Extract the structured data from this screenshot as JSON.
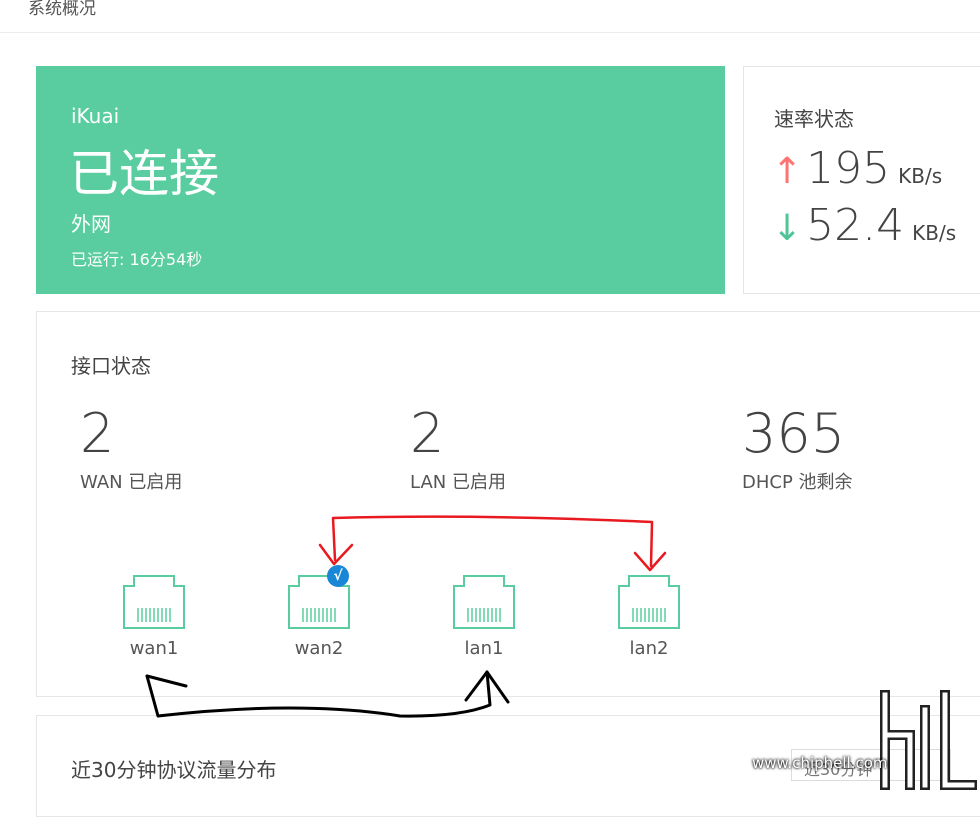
{
  "header": {
    "title": "系统概况"
  },
  "status": {
    "brand": "iKuai",
    "state": "已连接",
    "network": "外网",
    "uptime": "已运行: 16分54秒"
  },
  "rate": {
    "title": "速率状态",
    "upload": {
      "arrow": "↑",
      "value": "195",
      "unit": "KB/s"
    },
    "download": {
      "arrow": "↓",
      "value": "52.4",
      "unit": "KB/s"
    }
  },
  "interfaces": {
    "title": "接口状态",
    "stats": [
      {
        "value": "2",
        "label": "WAN 已启用"
      },
      {
        "value": "2",
        "label": "LAN 已启用"
      },
      {
        "value": "365",
        "label": "DHCP 池剩余"
      }
    ],
    "ports": [
      {
        "name": "wan1",
        "selected": false
      },
      {
        "name": "wan2",
        "selected": true,
        "badge": "√"
      },
      {
        "name": "lan1",
        "selected": false
      },
      {
        "name": "lan2",
        "selected": false
      }
    ]
  },
  "protocol": {
    "title": "近30分钟协议流量分布",
    "range": "近30分钟"
  },
  "watermark": {
    "logo": "chiphell",
    "url": "www.chiphell.com"
  },
  "colors": {
    "status_bg": "#59cd9f",
    "upload_arrow": "#ff7272",
    "download_arrow": "#4fc597",
    "port_outline": "#59cd9f",
    "badge": "#1a86d6",
    "annotation_red": "#e8191f",
    "annotation_black": "#000000"
  }
}
